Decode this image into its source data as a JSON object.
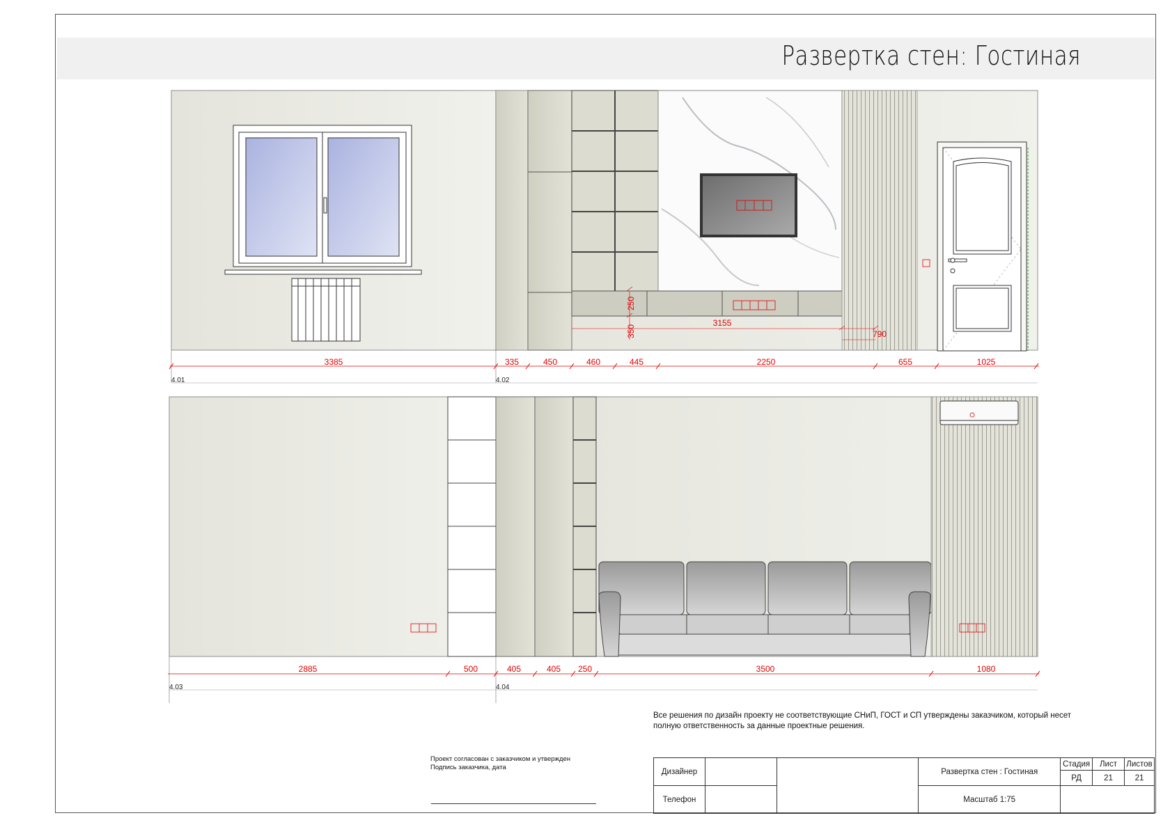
{
  "header": {
    "title": "Развертка стен: Гостиная"
  },
  "walls": [
    {
      "label": "4.01",
      "dims": [
        "3385"
      ]
    },
    {
      "label": "4.02",
      "dims": [
        "335",
        "450",
        "460",
        "445",
        "2250",
        "655",
        "1025"
      ],
      "vertical_dims": [
        "250",
        "350"
      ],
      "inner_dims": [
        "3155",
        "790"
      ]
    },
    {
      "label": "4.03",
      "dims": [
        "2885",
        "500"
      ]
    },
    {
      "label": "4.04",
      "dims": [
        "405",
        "405",
        "250",
        "3500",
        "1080"
      ]
    }
  ],
  "note": "Все решения по дизайн проекту не соответствующие СНиП, ГОСТ и СП утверждены заказчиком, который несет полную ответственность за данные проектные решения.",
  "approval": {
    "line1": "Проект согласован с заказчиком и утвержден",
    "line2": "Подпись заказчика, дата"
  },
  "stamp": {
    "designer_label": "Дизайнер",
    "phone_label": "Телефон",
    "sheet_title": "Развертка стен : Гостиная",
    "scale": "Масштаб 1:75",
    "stage_label": "Стадия",
    "sheet_label": "Лист",
    "sheets_label": "Листов",
    "stage": "РД",
    "sheet": "21",
    "sheets": "21"
  }
}
